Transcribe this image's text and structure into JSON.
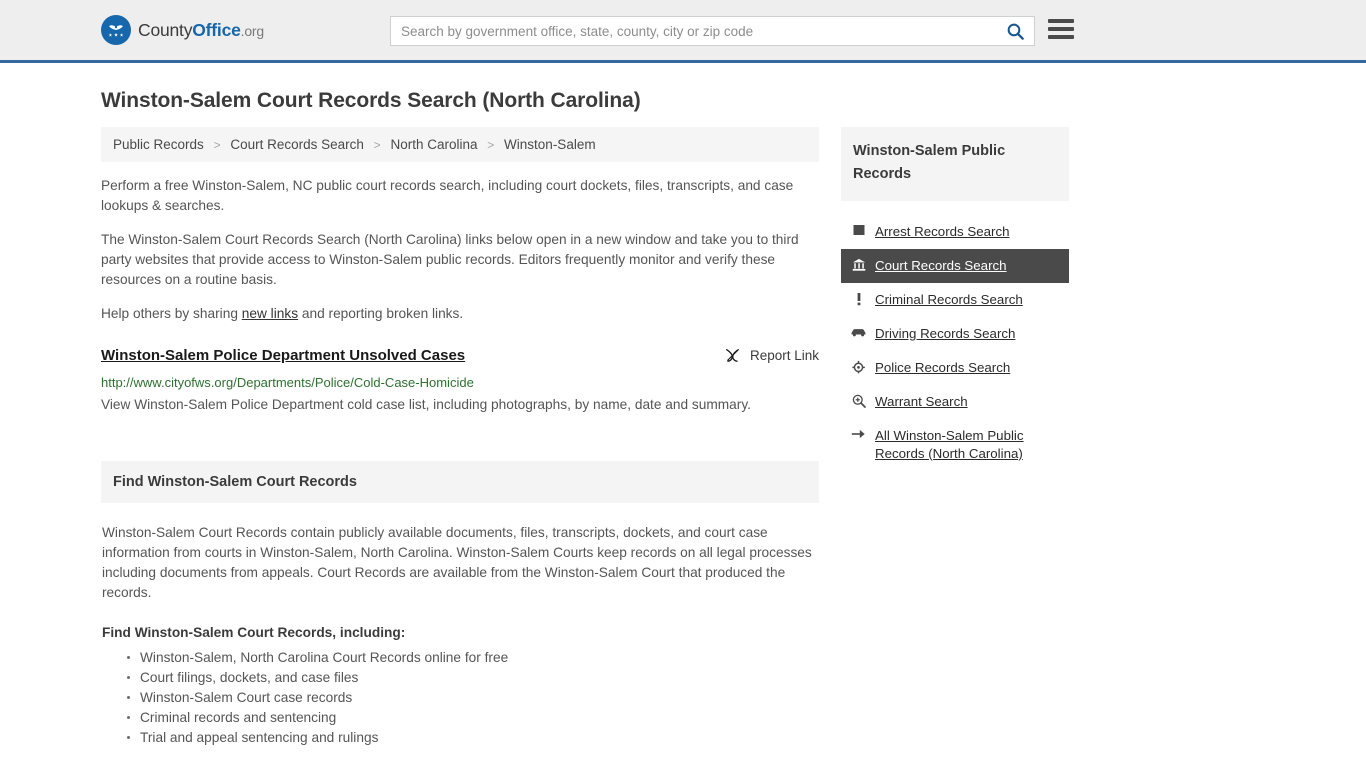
{
  "header": {
    "brand": {
      "part1": "County",
      "part2": "Office",
      "part3": ".org",
      "logo_icon": "eagle-shield-logo"
    },
    "search": {
      "placeholder": "Search by government office, state, county, city or zip code",
      "value": "",
      "icon": "search-icon"
    },
    "menu_icon": "hamburger-menu-icon",
    "accent_color": "#36699e",
    "background_color": "#eeeeee"
  },
  "page": {
    "title": "Winston-Salem Court Records Search (North Carolina)"
  },
  "breadcrumb": {
    "items": [
      {
        "label": "Public Records"
      },
      {
        "label": "Court Records Search"
      },
      {
        "label": "North Carolina"
      },
      {
        "label": "Winston-Salem"
      }
    ],
    "separator": ">"
  },
  "intro": {
    "p1": "Perform a free Winston-Salem, NC public court records search, including court dockets, files, transcripts, and case lookups & searches.",
    "p2": "The Winston-Salem Court Records Search (North Carolina) links below open in a new window and take you to third party websites that provide access to Winston-Salem public records. Editors frequently monitor and verify these resources on a routine basis.",
    "p3_before": "Help others by sharing ",
    "p3_link": "new links",
    "p3_after": " and reporting broken links."
  },
  "result": {
    "title": "Winston-Salem Police Department Unsolved Cases",
    "report_label": "Report Link",
    "report_icon": "broken-link-icon",
    "url": "http://www.cityofws.org/Departments/Police/Cold-Case-Homicide",
    "url_color": "#2f7031",
    "description": "View Winston-Salem Police Department cold case list, including photographs, by name, date and summary."
  },
  "section": {
    "heading": "Find Winston-Salem Court Records",
    "intro": "Winston-Salem Court Records contain publicly available documents, files, transcripts, dockets, and court case information from courts in Winston-Salem, North Carolina. Winston-Salem Courts keep records on all legal processes including documents from appeals. Court Records are available from the Winston-Salem Court that produced the records.",
    "list_heading": "Find Winston-Salem Court Records, including:",
    "bullets": [
      "Winston-Salem, North Carolina Court Records online for free",
      "Court filings, dockets, and case files",
      "Winston-Salem Court case records",
      "Criminal records and sentencing",
      "Trial and appeal sentencing and rulings"
    ]
  },
  "sidebar": {
    "heading": "Winston-Salem Public Records",
    "active_background": "#4a4a4a",
    "items": [
      {
        "label": "Arrest Records Search",
        "icon": "id-card-icon",
        "active": false
      },
      {
        "label": "Court Records Search",
        "icon": "courthouse-icon",
        "active": true
      },
      {
        "label": "Criminal Records Search",
        "icon": "exclamation-icon",
        "active": false
      },
      {
        "label": "Driving Records Search",
        "icon": "car-icon",
        "active": false
      },
      {
        "label": "Police Records Search",
        "icon": "police-badge-icon",
        "active": false
      },
      {
        "label": "Warrant Search",
        "icon": "magnifier-plus-icon",
        "active": false
      },
      {
        "label": "All Winston-Salem Public Records (North Carolina)",
        "icon": "arrow-right-icon",
        "active": false
      }
    ]
  }
}
